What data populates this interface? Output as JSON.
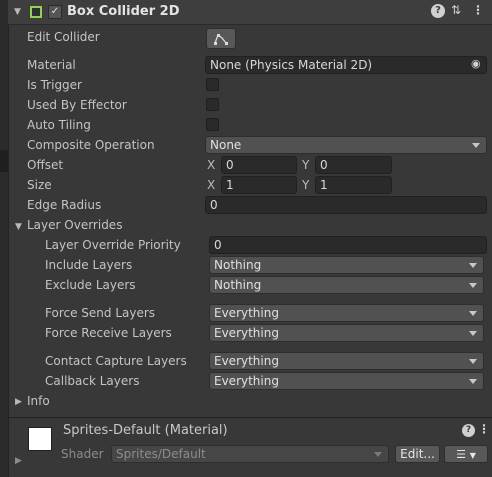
{
  "component": {
    "title": "Box Collider 2D",
    "edit_collider_label": "Edit Collider",
    "material_label": "Material",
    "material_value": "None (Physics Material 2D)",
    "is_trigger_label": "Is Trigger",
    "used_by_effector_label": "Used By Effector",
    "auto_tiling_label": "Auto Tiling",
    "composite_label": "Composite Operation",
    "composite_value": "None",
    "offset_label": "Offset",
    "offset_x": "0",
    "offset_y": "0",
    "size_label": "Size",
    "size_x": "1",
    "size_y": "1",
    "x_axis": "X",
    "y_axis": "Y",
    "edge_radius_label": "Edge Radius",
    "edge_radius_value": "0",
    "layer_overrides_label": "Layer Overrides",
    "layer_override_priority_label": "Layer Override Priority",
    "layer_override_priority_value": "0",
    "include_layers_label": "Include Layers",
    "include_layers_value": "Nothing",
    "exclude_layers_label": "Exclude Layers",
    "exclude_layers_value": "Nothing",
    "force_send_label": "Force Send Layers",
    "force_send_value": "Everything",
    "force_receive_label": "Force Receive Layers",
    "force_receive_value": "Everything",
    "contact_capture_label": "Contact Capture Layers",
    "contact_capture_value": "Everything",
    "callback_label": "Callback Layers",
    "callback_value": "Everything",
    "info_label": "Info"
  },
  "material_section": {
    "title": "Sprites-Default (Material)",
    "shader_label": "Shader",
    "shader_value": "Sprites/Default",
    "edit_button": "Edit..."
  },
  "icons": {
    "help": "?",
    "presets": "⇅",
    "more": "⋮",
    "checkmark": "✓",
    "object_picker": "◉"
  }
}
